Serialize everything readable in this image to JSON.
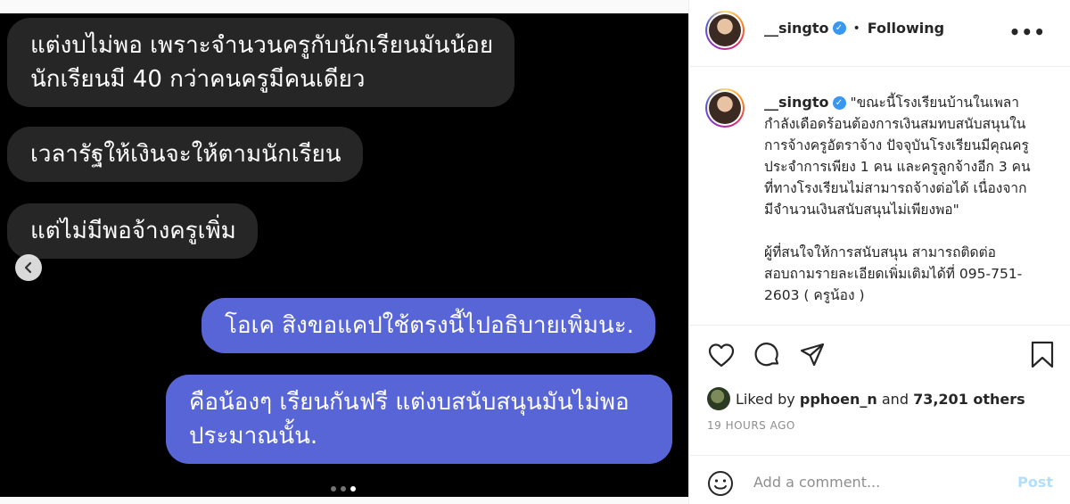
{
  "media": {
    "messages": [
      {
        "side": "received",
        "text": "แต่งบไม่พอ เพราะจำนวนครูกับนักเรียนมันน้อย\nนักเรียนมี 40 กว่าคนครูมีคนเดียว"
      },
      {
        "side": "received",
        "text": "เวลารัฐให้เงินจะให้ตามนักเรียน"
      },
      {
        "side": "received",
        "text": "แต่ไม่มีพอจ้างครูเพิ่ม"
      },
      {
        "side": "sent",
        "text": "โอเค สิงขอแคปใช้ตรงนี้ไปอธิบายเพิ่มนะ."
      },
      {
        "side": "sent",
        "text": "คือน้องๆ เรียนกันฟรี แต่งบสนับสนุนมันไม่พอ\nประมาณนั้น."
      }
    ],
    "prev_icon": "chevron-left-icon",
    "carousel": {
      "count": 3,
      "active_index": 2
    }
  },
  "header": {
    "username": "__singto",
    "separator": "•",
    "follow_status": "Following",
    "more_icon": "more-horizontal-icon"
  },
  "caption": {
    "username": "__singto",
    "lines": [
      "\"ขณะนี้โรงเรียนบ้านในเพลา",
      "กำลังเดือดร้อนต้องการเงินสมทบสนับสนุนใน",
      "การจ้างครูอัตราจ้าง ปัจจุบันโรงเรียนมีคุณครู",
      "ประจำการเพียง 1 คน และครูลูกจ้างอีก 3 คน",
      "ที่ทางโรงเรียนไม่สามารถจ้างต่อได้ เนื่องจาก",
      "มีจำนวนเงินสนับสนุนไม่เพียงพอ\"",
      "",
      "ผู้ที่สนใจให้การสนับสนุน สามารถติดต่อ",
      "สอบถามรายละเอียดเพิ่มเติมได้ที่ 095-751-",
      "2603 ( ครูน้อง )"
    ]
  },
  "actions": {
    "like_icon": "heart-icon",
    "comment_icon": "comment-icon",
    "share_icon": "send-icon",
    "save_icon": "bookmark-icon"
  },
  "likes": {
    "prefix": "Liked by",
    "user": "pphoen_n",
    "middle": "and",
    "others": "73,201 others"
  },
  "timestamp": "19 HOURS AGO",
  "comment": {
    "placeholder": "Add a comment...",
    "post_label": "Post",
    "emoji_icon": "smiley-icon"
  },
  "colors": {
    "sent_bubble": "#5865d6",
    "received_bubble": "#262626",
    "verified": "#3897f0",
    "post_disabled": "#b2dffc"
  }
}
